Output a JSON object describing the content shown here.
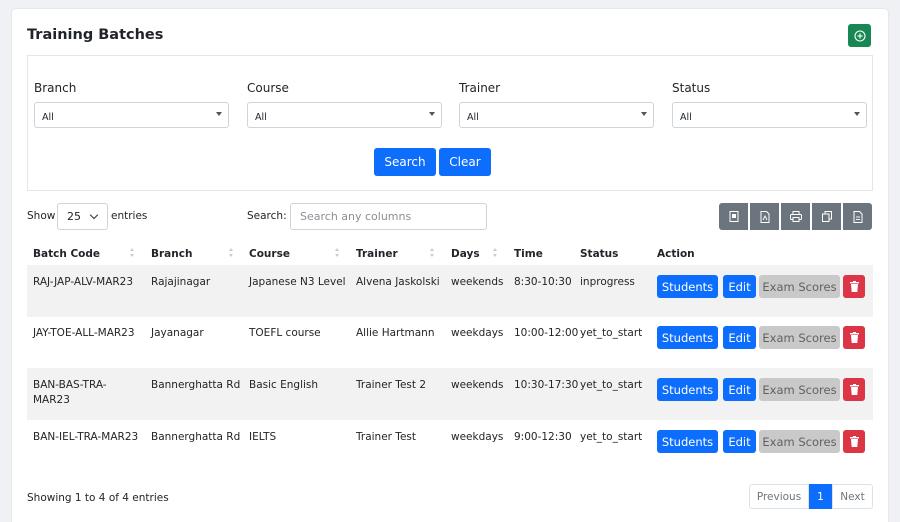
{
  "page": {
    "title": "Training Batches"
  },
  "filters": {
    "branch": {
      "label": "Branch",
      "value": "All"
    },
    "course": {
      "label": "Course",
      "value": "All"
    },
    "trainer": {
      "label": "Trainer",
      "value": "All"
    },
    "status": {
      "label": "Status",
      "value": "All"
    },
    "search_label": "Search",
    "clear_label": "Clear"
  },
  "table_controls": {
    "show_label": "Show",
    "entries_value": "25",
    "entries_label": "entries",
    "search_label": "Search:",
    "search_placeholder": "Search any columns"
  },
  "columns": [
    "Batch Code",
    "Branch",
    "Course",
    "Trainer",
    "Days",
    "Time",
    "Status",
    "Action"
  ],
  "rows": [
    {
      "batch_code": "RAJ-JAP-ALV-MAR23",
      "branch": "Rajajinagar",
      "course": "Japanese N3 Level",
      "trainer": "Alvena Jaskolski",
      "days": "weekends",
      "time": "8:30-10:30",
      "status": "inprogress"
    },
    {
      "batch_code": "JAY-TOE-ALL-MAR23",
      "branch": "Jayanagar",
      "course": "TOEFL course",
      "trainer": "Allie Hartmann",
      "days": "weekdays",
      "time": "10:00-12:00",
      "status": "yet_to_start"
    },
    {
      "batch_code": "BAN-BAS-TRA-MAR23",
      "branch": "Bannerghatta Rd",
      "course": "Basic English",
      "trainer": "Trainer Test 2",
      "days": "weekends",
      "time": "10:30-17:30",
      "status": "yet_to_start"
    },
    {
      "batch_code": "BAN-IEL-TRA-MAR23",
      "branch": "Bannerghatta Rd",
      "course": "IELTS",
      "trainer": "Trainer Test",
      "days": "weekdays",
      "time": "9:00-12:30",
      "status": "yet_to_start"
    }
  ],
  "actions": {
    "students": "Students",
    "edit": "Edit",
    "exam_scores": "Exam Scores"
  },
  "footer": {
    "info": "Showing 1 to 4 of 4 entries",
    "previous": "Previous",
    "current_page": "1",
    "next": "Next"
  },
  "colors": {
    "primary": "#0d6efd",
    "success": "#198754",
    "danger": "#dc3545",
    "secondary": "#6c757d"
  }
}
